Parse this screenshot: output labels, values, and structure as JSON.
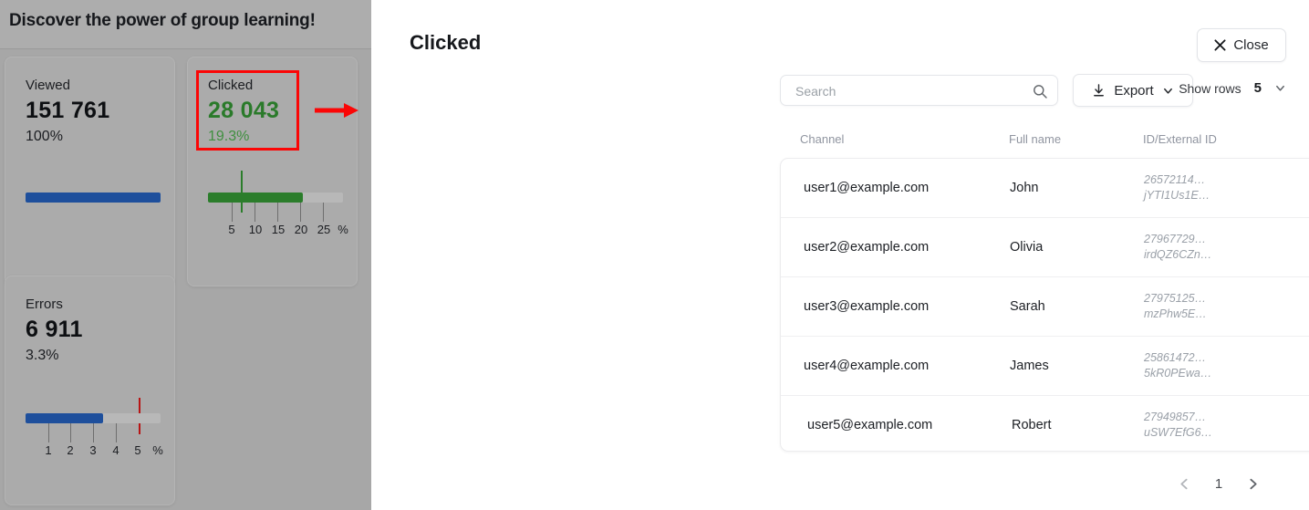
{
  "backdrop": {
    "title": "Discover the power of group learning!",
    "cards": [
      {
        "label": "Viewed",
        "value": "151 761",
        "percent": "100%",
        "color": "#1e4f9c",
        "fill_ratio": 1.0,
        "ticks": [],
        "unit": ""
      },
      {
        "label": "Clicked",
        "value": "28 043",
        "percent": "19.3%",
        "color": "#2b7d2b",
        "fill_ratio": 0.702,
        "marker_ratio": 0.255,
        "ticks": [
          "5",
          "10",
          "15",
          "20",
          "25"
        ],
        "unit": "%"
      },
      {
        "label": "Errors",
        "value": "6 911",
        "percent": "3.3%",
        "color": "#1e4f9c",
        "fill_ratio": 0.575,
        "marker_ratio": 0.845,
        "ticks": [
          "1",
          "2",
          "3",
          "4",
          "5"
        ],
        "unit": "%"
      }
    ],
    "annotation_color": "#fb0606"
  },
  "panel": {
    "title": "Clicked",
    "close_label": "Close",
    "search": {
      "placeholder": "Search",
      "value": ""
    },
    "export_label": "Export",
    "show_rows_label": "Show rows",
    "show_rows_value": "5",
    "table": {
      "columns": [
        "Channel",
        "Full name",
        "ID/External ID"
      ],
      "rows": [
        {
          "channel": "user1@example.com",
          "full_name": "John",
          "id_line1": "26572114…",
          "id_line2": "jYTI1Us1E…",
          "action_icon": "user-view-icon"
        },
        {
          "channel": "user2@example.com",
          "full_name": "Olivia",
          "id_line1": "27967729…",
          "id_line2": "irdQZ6CZn…",
          "action_icon": "user-view-icon"
        },
        {
          "channel": "user3@example.com",
          "full_name": "Sarah",
          "id_line1": "27975125…",
          "id_line2": "mzPhw5E…",
          "action_icon": "user-view-icon"
        },
        {
          "channel": "user4@example.com",
          "full_name": "James",
          "id_line1": "25861472…",
          "id_line2": "5kR0PEwa…",
          "action_icon": "user-view-icon"
        },
        {
          "channel": "user5@example.com",
          "full_name": "Robert",
          "id_line1": "27949857…",
          "id_line2": "uSW7EfG6…",
          "action_icon": "user-view-icon"
        }
      ]
    },
    "pagination": {
      "prev": "chevron-left-icon",
      "current_page": "1",
      "next": "chevron-right-icon"
    }
  }
}
